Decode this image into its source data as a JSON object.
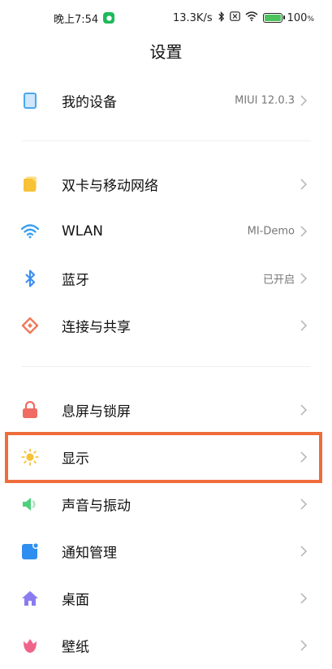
{
  "status_bar": {
    "time": "晚上7:54",
    "network_speed": "13.3K/s",
    "battery_percent": "100",
    "battery_unit": "%",
    "icons": [
      "wechat-icon",
      "bluetooth-icon",
      "no-sim-icon",
      "wifi-icon",
      "battery-charging-icon"
    ]
  },
  "header": {
    "title": "设置"
  },
  "groups": [
    {
      "items": [
        {
          "label": "我的设备",
          "value": "MIUI 12.0.3",
          "icon": "phone-device-icon",
          "color": "#4aa8ef"
        }
      ]
    },
    {
      "items": [
        {
          "label": "双卡与移动网络",
          "value": "",
          "icon": "sim-card-icon",
          "color": "#f8c236"
        },
        {
          "label": "WLAN",
          "value": "MI-Demo",
          "icon": "wifi-icon",
          "color": "#3aa0f0"
        },
        {
          "label": "蓝牙",
          "value": "已开启",
          "icon": "bluetooth-icon",
          "color": "#3d8ff0"
        },
        {
          "label": "连接与共享",
          "value": "",
          "icon": "connection-share-icon",
          "color": "#ef7a5a"
        }
      ]
    },
    {
      "items": [
        {
          "label": "息屏与锁屏",
          "value": "",
          "icon": "lock-icon",
          "color": "#f06b63"
        },
        {
          "label": "显示",
          "value": "",
          "icon": "sun-icon",
          "color": "#f8c236",
          "highlighted": true
        },
        {
          "label": "声音与振动",
          "value": "",
          "icon": "speaker-icon",
          "color": "#4fd07c"
        },
        {
          "label": "通知管理",
          "value": "",
          "icon": "notification-icon",
          "color": "#2f8ff0"
        },
        {
          "label": "桌面",
          "value": "",
          "icon": "home-icon",
          "color": "#8a7cf0"
        },
        {
          "label": "壁纸",
          "value": "",
          "icon": "wallpaper-flower-icon",
          "color": "#f0648a"
        }
      ]
    }
  ],
  "colors": {
    "highlight_border": "#ee6d3a",
    "chevron": "#b3b3b3"
  }
}
